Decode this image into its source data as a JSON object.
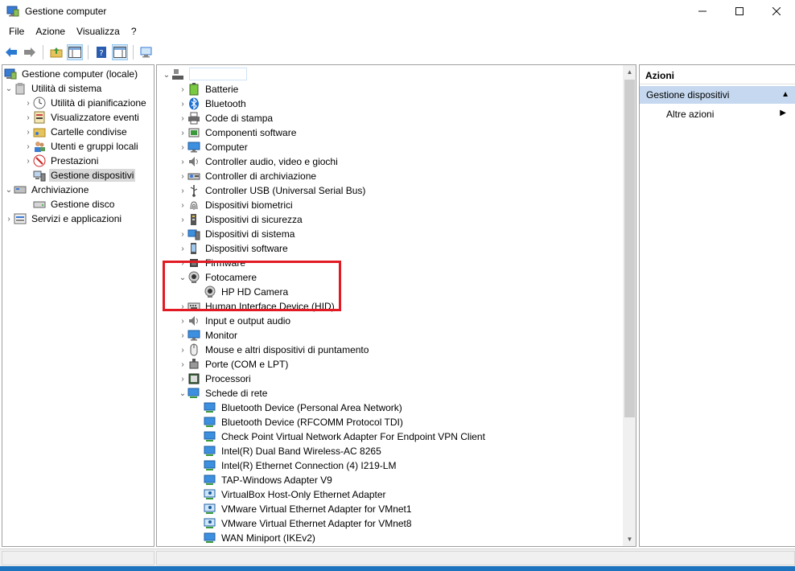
{
  "window": {
    "title": "Gestione computer"
  },
  "menu": [
    "File",
    "Azione",
    "Visualizza",
    "?"
  ],
  "left_tree": {
    "root": "Gestione computer (locale)",
    "system_tools": "Utilità di sistema",
    "system_children": [
      "Utilità di pianificazione",
      "Visualizzatore eventi",
      "Cartelle condivise",
      "Utenti e gruppi locali",
      "Prestazioni",
      "Gestione dispositivi"
    ],
    "storage": "Archiviazione",
    "storage_children": [
      "Gestione disco"
    ],
    "services": "Servizi e applicazioni"
  },
  "device_tree": {
    "categories_top": [
      "Batterie",
      "Bluetooth",
      "Code di stampa",
      "Componenti software",
      "Computer",
      "Controller audio, video e giochi",
      "Controller di archiviazione",
      "Controller USB (Universal Serial Bus)",
      "Dispositivi biometrici",
      "Dispositivi di sicurezza",
      "Dispositivi di sistema",
      "Dispositivi software",
      "Firmware"
    ],
    "cameras": "Fotocamere",
    "camera_children": [
      "HP HD Camera"
    ],
    "categories_mid": [
      "Human Interface Device (HID)",
      "Input e output audio",
      "Monitor",
      "Mouse e altri dispositivi di puntamento",
      "Porte (COM e LPT)",
      "Processori"
    ],
    "network": "Schede di rete",
    "network_children": [
      "Bluetooth Device (Personal Area Network)",
      "Bluetooth Device (RFCOMM Protocol TDI)",
      "Check Point Virtual Network Adapter For Endpoint VPN Client",
      "Intel(R) Dual Band Wireless-AC 8265",
      "Intel(R) Ethernet Connection (4) I219-LM",
      "TAP-Windows Adapter V9",
      "VirtualBox Host-Only Ethernet Adapter",
      "VMware Virtual Ethernet Adapter for VMnet1",
      "VMware Virtual Ethernet Adapter for VMnet8",
      "WAN Miniport (IKEv2)"
    ]
  },
  "actions": {
    "header": "Azioni",
    "section": "Gestione dispositivi",
    "item": "Altre azioni"
  },
  "colors": {
    "highlight": "#e21a23",
    "actions_section": "#c5d8ef",
    "taskbar": "#1e73be"
  }
}
